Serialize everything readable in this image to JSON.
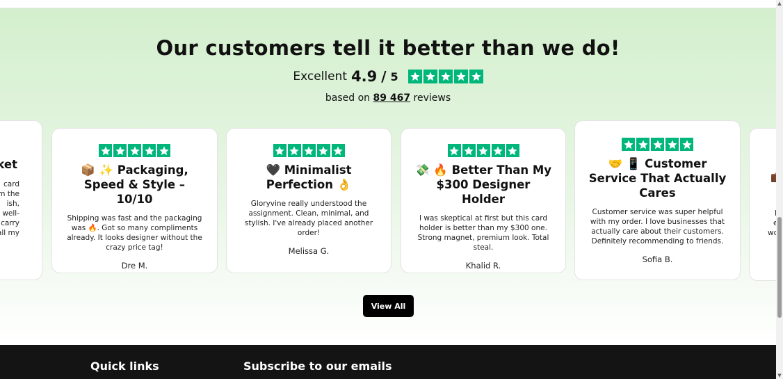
{
  "section": {
    "heading": "Our customers tell it better than we do!",
    "rating_word": "Excellent",
    "rating_score": "4.9",
    "rating_slash": "/",
    "rating_max": "5",
    "rating_value": 4.9,
    "based_prefix": "based on",
    "review_count": "89 467",
    "based_suffix": "reviews",
    "star_color": "#00b67a"
  },
  "left_partial": {
    "title": "ket",
    "lines": [
      "card",
      "m the",
      "ish,",
      "d well-",
      "o carry",
      "all my"
    ]
  },
  "reviews": [
    {
      "title": "📦 ✨ Packaging, Speed & Style – 10/10",
      "body": "Shipping was fast and the packaging was 🔥. Got so many compliments already. It looks designer without the crazy price tag!",
      "author": "Dre M.",
      "stars": 5
    },
    {
      "title": "🖤 Minimalist Perfection 👌",
      "body": "Gloryvine really understood the assignment. Clean, minimal, and stylish. I've already placed another order!",
      "author": "Melissa G.",
      "stars": 5
    },
    {
      "title": "💸 🔥 Better Than My $300 Designer Holder",
      "body": "I was skeptical at first but this card holder is better than my $300 one. Strong magnet, premium look. Total steal.",
      "author": "Khalid R.",
      "stars": 5
    },
    {
      "title": "🤝 📱 Customer Service That Actually Cares",
      "body": "Customer service was super helpful with my order. I love businesses that actually care about their customers. Definitely recommending to friends.",
      "author": "Sofia B.",
      "stars": 5
    }
  ],
  "right_partial": {
    "icon": "💼",
    "lines": [
      "E",
      "e",
      "wo"
    ]
  },
  "view_all_label": "View All",
  "footer": {
    "quick_links": "Quick links",
    "subscribe": "Subscribe to our emails"
  }
}
